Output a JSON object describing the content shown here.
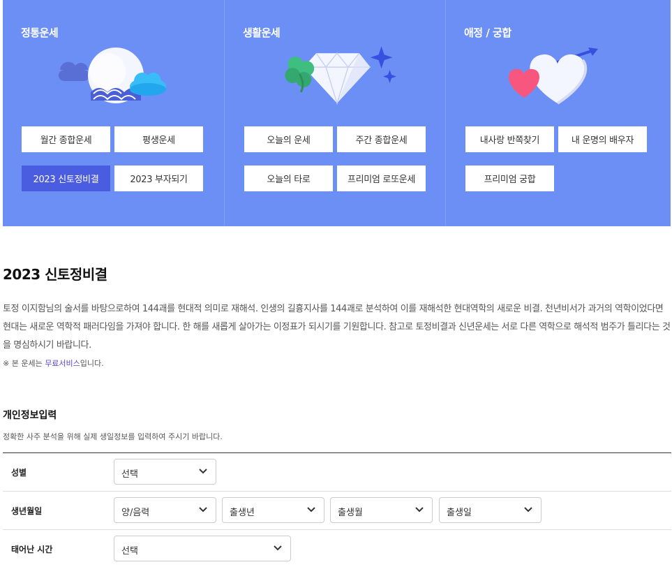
{
  "categories": [
    {
      "title": "정통운세",
      "buttons": [
        "월간 종합운세",
        "평생운세",
        "2023 신토정비결",
        "2023 부자되기"
      ],
      "active_index": 2
    },
    {
      "title": "생활운세",
      "buttons": [
        "오늘의 운세",
        "주간 종합운세",
        "오늘의 타로",
        "프리미엄 로또운세"
      ],
      "active_index": -1
    },
    {
      "title": "애정 / 궁합",
      "buttons": [
        "내사랑 반쪽찾기",
        "내 운명의 배우자",
        "프리미엄 궁합"
      ],
      "active_index": -1
    }
  ],
  "page": {
    "title": "2023 신토정비결",
    "description": "토정 이지함님의 술서를 바탕으로하여 144괘를 현대적 의미로 재해석. 인생의 길흉지사를 144괘로 분석하여 이를 재해석한 현대역학의 새로운 비결. 천년비서가 과거의 역학이었다면 현대는 새로운 역학적 패러다임을 가져야 합니다. 한 해를 새롭게 살아가는 이정표가 되시기를 기원합니다. 참고로 토정비결과 신년운세는 서로 다른 역학으로 해석적 범주가 틀리다는 것을 명심하시기 바랍니다.",
    "note_prefix": "※ 본 운세는 ",
    "note_link": "무료서비스",
    "note_suffix": "입니다."
  },
  "form": {
    "title": "개인정보입력",
    "subtitle": "정확한 사주 분석을 위해 실제 생일정보를 입력하여 주시기 바랍니다.",
    "gender": {
      "label": "성별",
      "value": "선택"
    },
    "birth": {
      "label": "생년월일",
      "calendar": "양/음력",
      "year": "출생년",
      "month": "출생월",
      "day": "출생일"
    },
    "birth_time": {
      "label": "태어난 시간",
      "value": "선택"
    }
  },
  "colors": {
    "banner_bg": "#6c8ff5",
    "active_button": "#4a5de0",
    "link": "#5a45c9"
  },
  "icons": [
    "moon-cloud-icon",
    "clover-diamond-icon",
    "hearts-arrow-icon",
    "chevron-down-icon"
  ]
}
